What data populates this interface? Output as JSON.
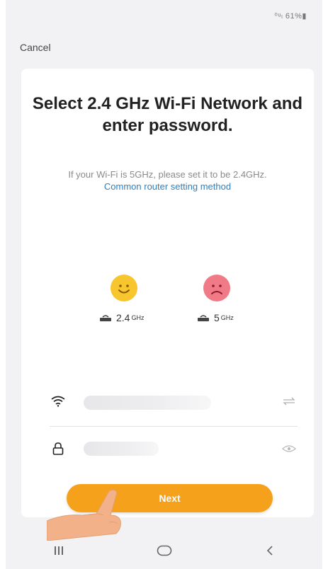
{
  "status_bar": {
    "text": "⁰ᵘₗ 61%▮"
  },
  "header": {
    "cancel_label": "Cancel"
  },
  "card": {
    "title": "Select 2.4 GHz Wi-Fi Network and enter password.",
    "hint_prefix": "If your Wi-Fi is 5GHz, please set it to be 2.4GHz.",
    "hint_link": "Common router setting method"
  },
  "bands": [
    {
      "mood": "happy",
      "value": "2.4",
      "unit": "GHz",
      "color": "#f7c52e"
    },
    {
      "mood": "sad",
      "value": "5",
      "unit": "GHz",
      "color": "#f07a86"
    }
  ],
  "fields": {
    "wifi": {
      "icon": "wifi-icon",
      "action_icon": "switch-network-icon"
    },
    "password": {
      "icon": "lock-icon",
      "action_icon": "eye-icon"
    }
  },
  "actions": {
    "next_label": "Next"
  },
  "nav": {
    "recents": "recents-icon",
    "home": "home-icon",
    "back": "back-icon"
  },
  "colors": {
    "accent": "#f5a11c",
    "link": "#2f7fbf",
    "background": "#f2f2f4"
  }
}
